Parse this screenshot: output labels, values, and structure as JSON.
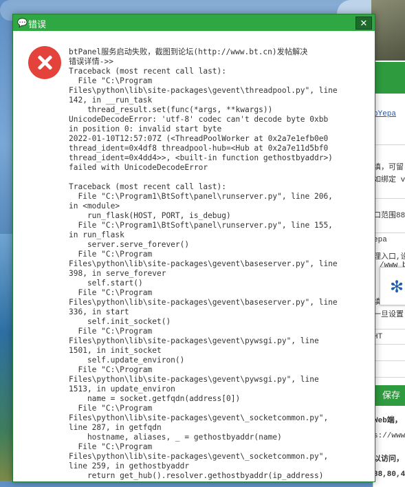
{
  "dialog": {
    "title": "错误",
    "close_label": "✕",
    "message_lines": [
      "btPanel服务启动失败，截图到论坛(http://www.bt.cn)发帖解决",
      "错误详情->>",
      "Traceback (most recent call last):",
      "  File \"C:\\Program",
      "Files\\python\\lib\\site-packages\\gevent\\threadpool.py\", line",
      "142, in __run_task",
      "    thread_result.set(func(*args, **kwargs))",
      "UnicodeDecodeError: 'utf-8' codec can't decode byte 0xbb",
      "in position 0: invalid start byte",
      "2022-01-10T12:57:07Z (<ThreadPoolWorker at 0x2a7e1efb0e0",
      "thread_ident=0x4df8 threadpool-hub=<Hub at 0x2a7e11d5bf0",
      "thread_ident=0x4dd4>>, <built-in function gethostbyaddr>)",
      "failed with UnicodeDecodeError",
      "",
      "Traceback (most recent call last):",
      "  File \"C:\\Program1\\BtSoft\\panel\\runserver.py\", line 206,",
      "in <module>",
      "    run_flask(HOST, PORT, is_debug)",
      "  File \"C:\\Program1\\BtSoft\\panel\\runserver.py\", line 155,",
      "in run_flask",
      "    server.serve_forever()",
      "  File \"C:\\Program",
      "Files\\python\\lib\\site-packages\\gevent\\baseserver.py\", line",
      "398, in serve_forever",
      "    self.start()",
      "  File \"C:\\Program",
      "Files\\python\\lib\\site-packages\\gevent\\baseserver.py\", line",
      "336, in start",
      "    self.init_socket()",
      "  File \"C:\\Program",
      "Files\\python\\lib\\site-packages\\gevent\\pywsgi.py\", line",
      "1501, in init_socket",
      "    self.update_environ()",
      "  File \"C:\\Program",
      "Files\\python\\lib\\site-packages\\gevent\\pywsgi.py\", line",
      "1513, in update_environ",
      "    name = socket.getfqdn(address[0])",
      "  File \"C:\\Program",
      "Files\\python\\lib\\site-packages\\gevent\\_socketcommon.py\",",
      "line 287, in getfqdn",
      "    hostname, aliases, _ = gethostbyaddr(name)",
      "  File \"C:\\Program",
      "Files\\python\\lib\\site-packages\\gevent\\_socketcommon.py\",",
      "line 259, in gethostbyaddr",
      "    return get_hub().resolver.gethostbyaddr(ip_address)"
    ]
  },
  "background_app": {
    "link_text": "bYepa",
    "snippets": [
      "填，可留",
      "如绑定 v",
      "口范围88",
      "epa",
      "理入口,设",
      "/www_b",
      "填",
      "一旦设置",
      "HT",
      "Web端，",
      "s://www",
      "以访问，",
      "88,80,4"
    ],
    "save_button": "保存配"
  },
  "colors": {
    "titlebar": "#2fa743",
    "error_icon": "#e3433a",
    "accent_green": "#2e9b3f"
  }
}
